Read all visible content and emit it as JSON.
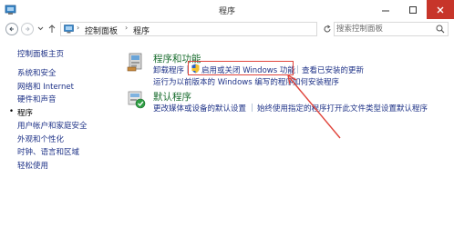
{
  "window": {
    "title": "程序",
    "minimize_icon": "minimize-icon",
    "maximize_icon": "maximize-icon",
    "close_icon": "close-icon",
    "close_color": "#c7352a"
  },
  "address": {
    "breadcrumbs": [
      "控制面板",
      "程序"
    ],
    "separator": "›",
    "search_placeholder": "搜索控制面板"
  },
  "sidebar": {
    "home": "控制面板主页",
    "items": [
      {
        "label": "系统和安全",
        "current": false
      },
      {
        "label": "网络和 Internet",
        "current": false
      },
      {
        "label": "硬件和声音",
        "current": false
      },
      {
        "label": "程序",
        "current": true
      },
      {
        "label": "用户帐户和家庭安全",
        "current": false
      },
      {
        "label": "外观和个性化",
        "current": false
      },
      {
        "label": "时钟、语言和区域",
        "current": false
      },
      {
        "label": "轻松使用",
        "current": false
      }
    ]
  },
  "sections": {
    "programs_features": {
      "title": "程序和功能",
      "links": {
        "uninstall": "卸载程序",
        "turn_features": "启用或关闭 Windows 功能",
        "view_updates": "查看已安装的更新",
        "run_old": "运行为以前版本的 Windows 编写的程序",
        "how_install": "如何安装程序"
      }
    },
    "default_programs": {
      "title": "默认程序",
      "links": {
        "change_defaults": "更改媒体或设备的默认设置",
        "always_open": "始终使用指定的程序打开此文件类型",
        "set_defaults": "设置默认程序"
      }
    }
  },
  "colors": {
    "link": "#1e3287",
    "section_title": "#1a6d2f",
    "annotation": "#e0443b"
  }
}
